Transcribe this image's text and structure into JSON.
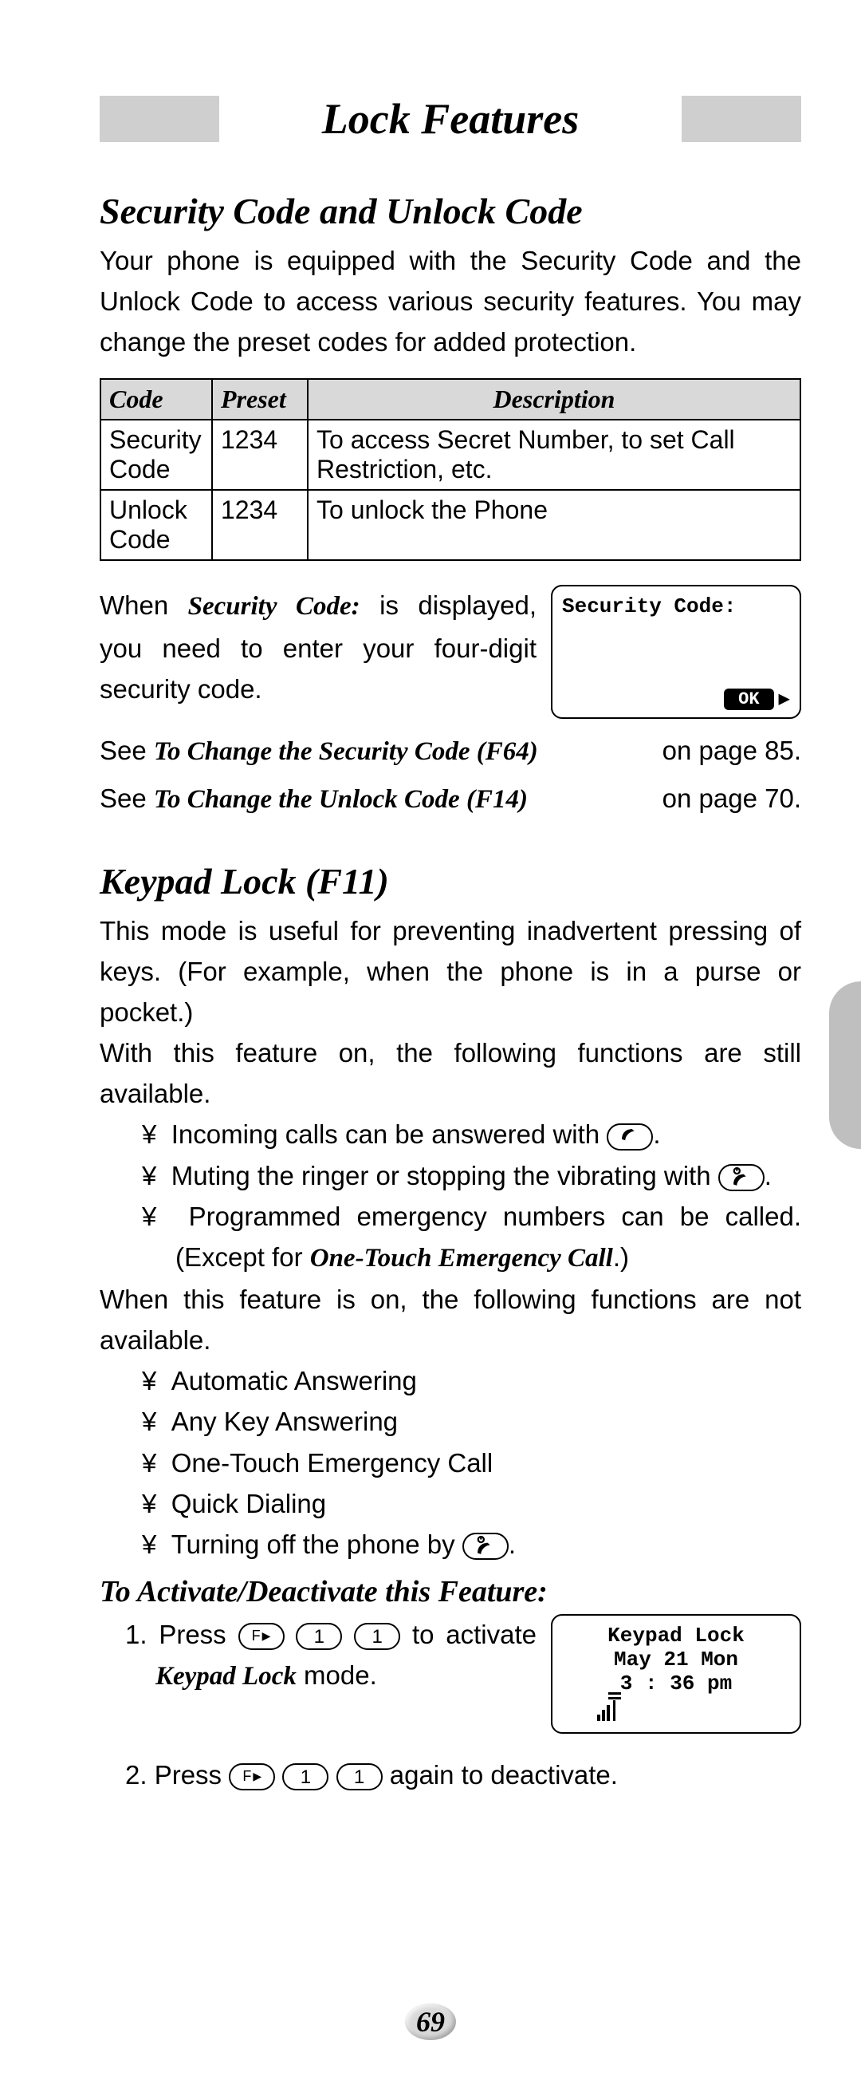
{
  "chapter_title": "Lock Features",
  "page_number": "69",
  "section1": {
    "heading": "Security Code and Unlock Code",
    "intro": "Your phone is equipped with the Security Code and the Unlock Code to access various security features. You may change the preset codes for added protection.",
    "table": {
      "headers": {
        "code": "Code",
        "preset": "Preset",
        "description": "Description"
      },
      "rows": [
        {
          "code": "Security Code",
          "preset": "1234",
          "description": "To access Secret Number, to set Call Restriction, etc."
        },
        {
          "code": "Unlock Code",
          "preset": "1234",
          "description": "To unlock the Phone"
        }
      ]
    },
    "prompt_para_pre": "When ",
    "prompt_label": "Security Code:",
    "prompt_para_post": " is displayed, you need to enter your four-digit security code.",
    "screen": {
      "line1": "Security Code:",
      "ok": "OK"
    },
    "ref1_pre": "See ",
    "ref1_title": "To Change the Security Code (F64)",
    "ref1_page": "on page 85.",
    "ref2_pre": "See ",
    "ref2_title": "To Change the Unlock Code (F14)",
    "ref2_page": "on page 70."
  },
  "section2": {
    "heading": "Keypad Lock (F11)",
    "para1": "This mode is useful for preventing inadvertent pressing of keys. (For example, when the phone is in a purse or pocket.)",
    "para2": "With this feature on, the following functions are still available.",
    "avail": [
      {
        "pre": "Incoming calls can be answered with",
        "icon": "call",
        "post": "."
      },
      {
        "pre": "Muting the ringer or stopping the vibrating with",
        "icon": "power",
        "post": "."
      },
      {
        "pre": "Programmed emergency numbers can be called. (Except for ",
        "ital": "One-Touch Emergency Call",
        "post_ital": ".)"
      }
    ],
    "para3": "When this feature is on, the following functions are not available.",
    "notavail": [
      "Automatic Answering",
      "Any Key Answering",
      "One-Touch Emergency Call",
      "Quick Dialing"
    ],
    "notavail_last_pre": "Turning off the phone by",
    "notavail_last_icon": "power",
    "sub_heading": "To Activate/Deactivate this Feature:",
    "step1_pre": "Press ",
    "step1_mid": " to activate ",
    "step1_ital": "Keypad Lock",
    "step1_post": " mode.",
    "screen": {
      "l1": "Keypad Lock",
      "l2": "May 21 Mon",
      "l3": "3 : 36 pm"
    },
    "step2_pre": "Press ",
    "step2_post": " again to deactivate.",
    "keys": {
      "fn": "F",
      "one": "1"
    }
  },
  "bullet": "¥"
}
